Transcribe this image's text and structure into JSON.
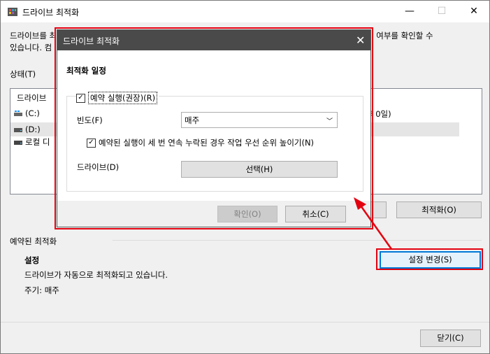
{
  "main": {
    "title": "드라이브 최적화",
    "description_line1": "드라이브를 최",
    "description_line1_right": "지 여부를 확인할 수",
    "description_line2": "있습니다. 컴",
    "status_label": "상태(T)",
    "drive_header": "드라이브",
    "drives": [
      {
        "name": "(C:)",
        "icon": "windows-drive-icon"
      },
      {
        "name": "(D:)",
        "icon": "hard-drive-icon"
      },
      {
        "name": "로컬 디",
        "icon": "local-drive-icon"
      }
    ],
    "drive_c_status_fragment": "후 0일)",
    "analyze_label": "",
    "optimize_label": "최적화(O)",
    "scheduled_label": "예약된 최적화",
    "setting_label": "설정",
    "scheduled_status": "드라이브가 자동으로 최적화되고 있습니다.",
    "frequency_text": "주기: 매주",
    "change_settings_label": "설정 변경(S)",
    "close_label": "닫기(C)"
  },
  "dialog": {
    "title": "드라이브 최적화",
    "heading": "최적화 일정",
    "run_scheduled_label": "예약 실행(권장)(R)",
    "run_scheduled_checked": true,
    "frequency_label": "빈도(F)",
    "frequency_value": "매주",
    "increase_priority_label": "예약된 실행이 세 번 연속 누락된 경우 작업 우선 순위 높이기(N)",
    "increase_priority_checked": true,
    "drives_label": "드라이브(D)",
    "choose_label": "선택(H)",
    "ok_label": "확인(O)",
    "cancel_label": "취소(C)"
  },
  "colors": {
    "highlight": "#e3000f",
    "dialog_titlebar": "#4a4a4a",
    "accent": "#0078d7"
  }
}
